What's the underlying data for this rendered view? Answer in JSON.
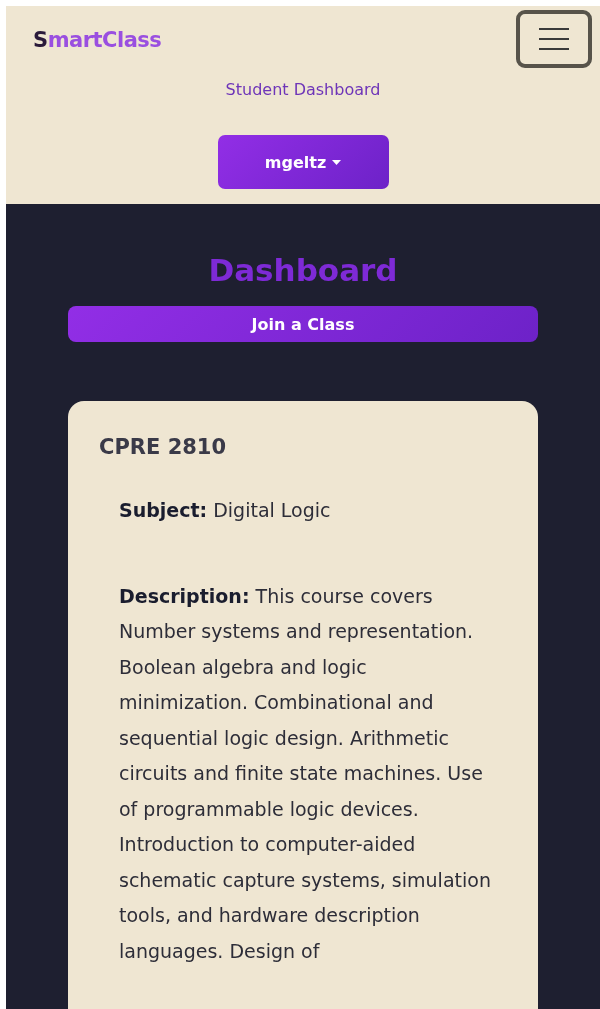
{
  "navbar": {
    "brand": "SmartClass",
    "subtitle": "Student Dashboard",
    "user_menu": "mgeltz"
  },
  "main": {
    "title": "Dashboard",
    "join_button": "Join a Class",
    "classes": [
      {
        "code": "CPRE 2810",
        "fields": [
          {
            "text": "**Subject:** Digital Logic"
          },
          {
            "text": "**Description:** This course covers Number systems and representation. Boolean algebra and logic minimization. Combinational and sequential logic design. Arithmetic circuits and finite state machines. Use of programmable logic devices. Introduction to computer-aided schematic capture systems, simulation tools, and hardware description languages. Design of"
          }
        ]
      }
    ]
  }
}
